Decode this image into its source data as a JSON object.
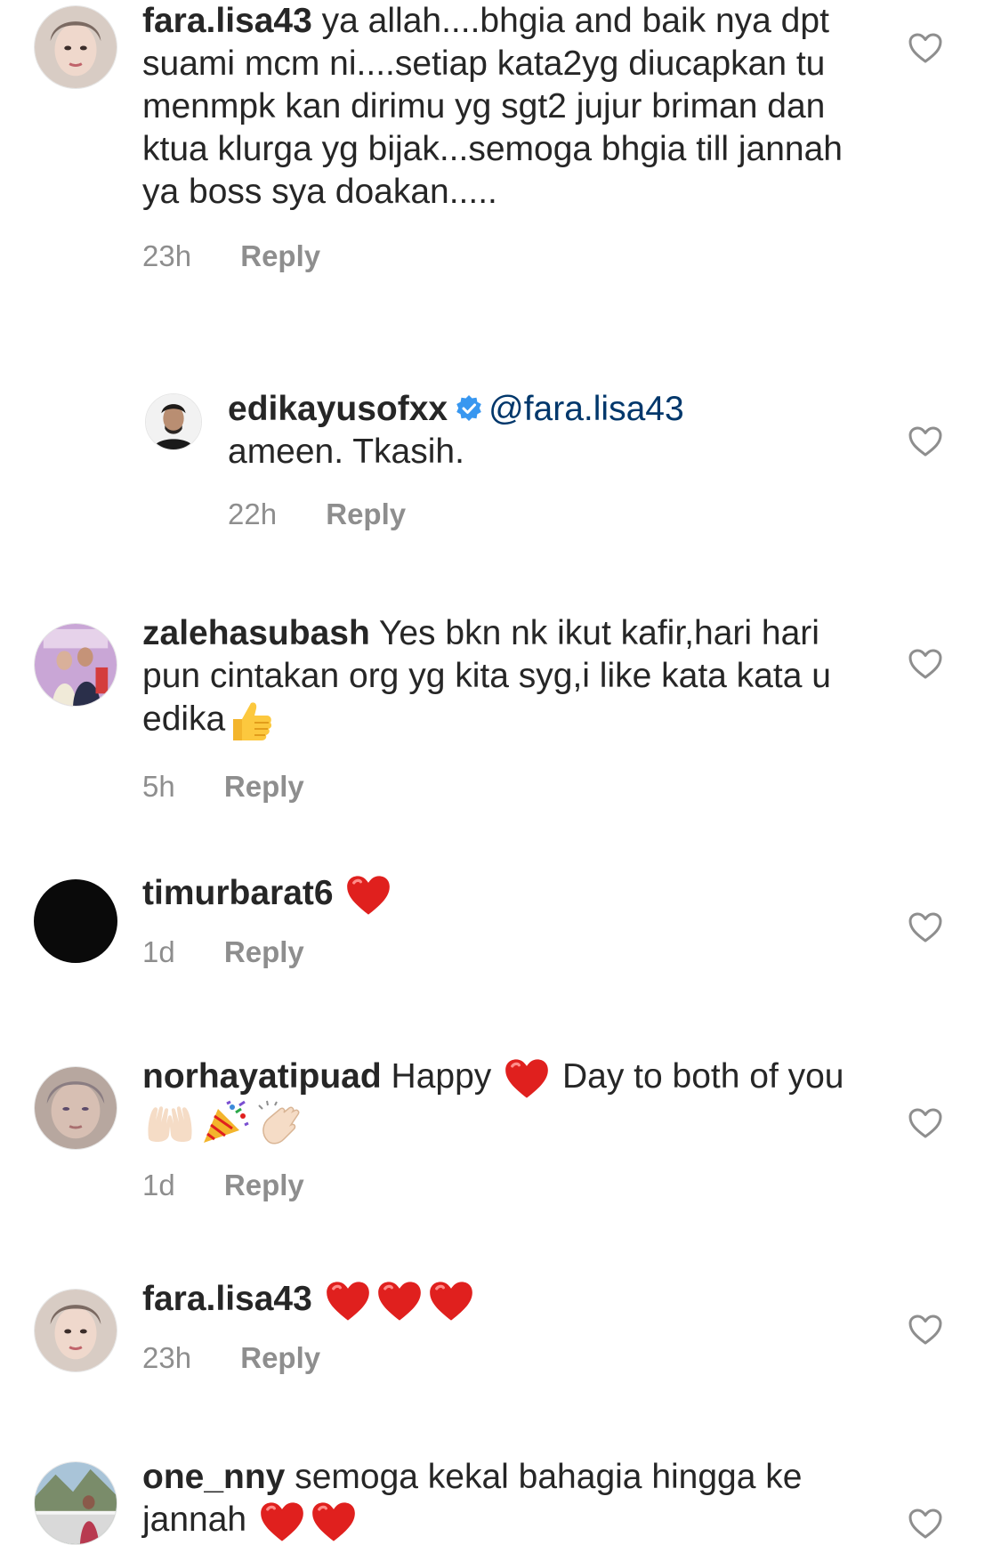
{
  "comments": [
    {
      "username": "fara.lisa43",
      "text": "ya allah....bhgia and baik nya dpt suami mcm ni....setiap kata2yg diucapkan  tu menmpk kan dirimu  yg sgt2 jujur briman dan ktua klurga yg bijak...semoga bhgia till jannah ya boss sya doakan.....",
      "time": "23h",
      "reply_label": "Reply"
    },
    {
      "username": "edikayusofxx",
      "mention": "@fara.lisa43",
      "text": "ameen. Tkasih.",
      "time": "22h",
      "reply_label": "Reply",
      "verified": true
    },
    {
      "username": "zalehasubash",
      "text": "Yes bkn nk ikut kafir,hari hari pun cintakan org yg kita syg,i like kata kata u edika",
      "time": "5h",
      "reply_label": "Reply",
      "emojis": [
        "thumbs-up"
      ]
    },
    {
      "username": "timurbarat6",
      "text": "",
      "time": "1d",
      "reply_label": "Reply",
      "emojis": [
        "red-heart"
      ]
    },
    {
      "username": "norhayatipuad",
      "text_before": "Happy",
      "text_after": "Day to both of you",
      "time": "1d",
      "reply_label": "Reply",
      "emojis": [
        "red-heart",
        "raised-palms",
        "party-popper",
        "clapping-hands"
      ]
    },
    {
      "username": "fara.lisa43",
      "text": "",
      "time": "23h",
      "reply_label": "Reply",
      "emojis": [
        "red-heart",
        "red-heart",
        "red-heart"
      ]
    },
    {
      "username": "one_nny",
      "text": "semoga kekal bahagia hingga ke jannah",
      "time": "",
      "reply_label": "",
      "emojis": [
        "red-heart",
        "red-heart"
      ]
    }
  ],
  "colors": {
    "text": "#262626",
    "secondary": "#8e8e8e",
    "mention": "#00376b",
    "verified": "#3897f0",
    "heart_emoji": "#e0201e"
  },
  "icons": {
    "like": "heart-outline-icon",
    "verified": "verified-badge-icon"
  }
}
